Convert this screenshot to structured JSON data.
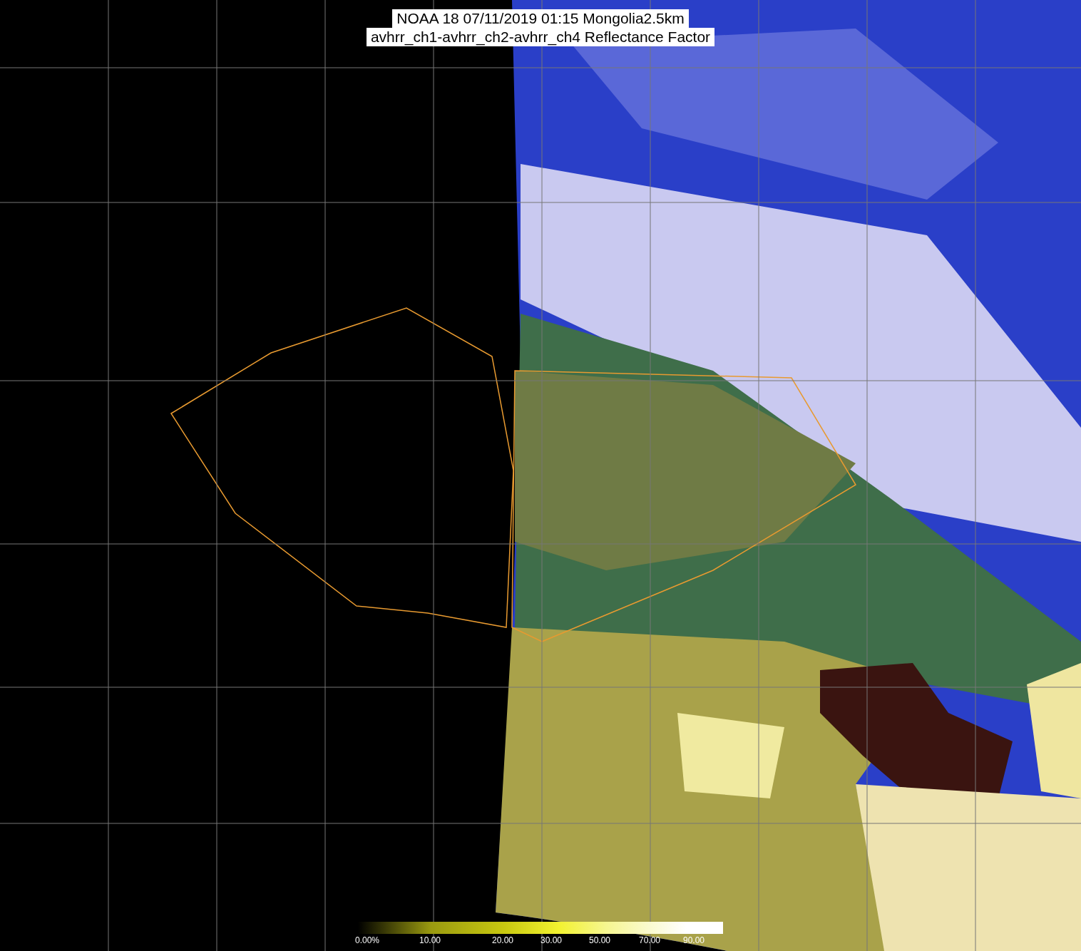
{
  "title": {
    "lines": [
      "NOAA 18 07/11/2019 01:15 Mongolia2.5km",
      "avhrr_ch1-avhrr_ch2-avhrr_ch4 Reflectance Factor"
    ]
  },
  "color_scale": {
    "labels": [
      "0.00%",
      "10.00",
      "20.00",
      "30.00",
      "50.00",
      "70.00",
      "90.00"
    ]
  }
}
